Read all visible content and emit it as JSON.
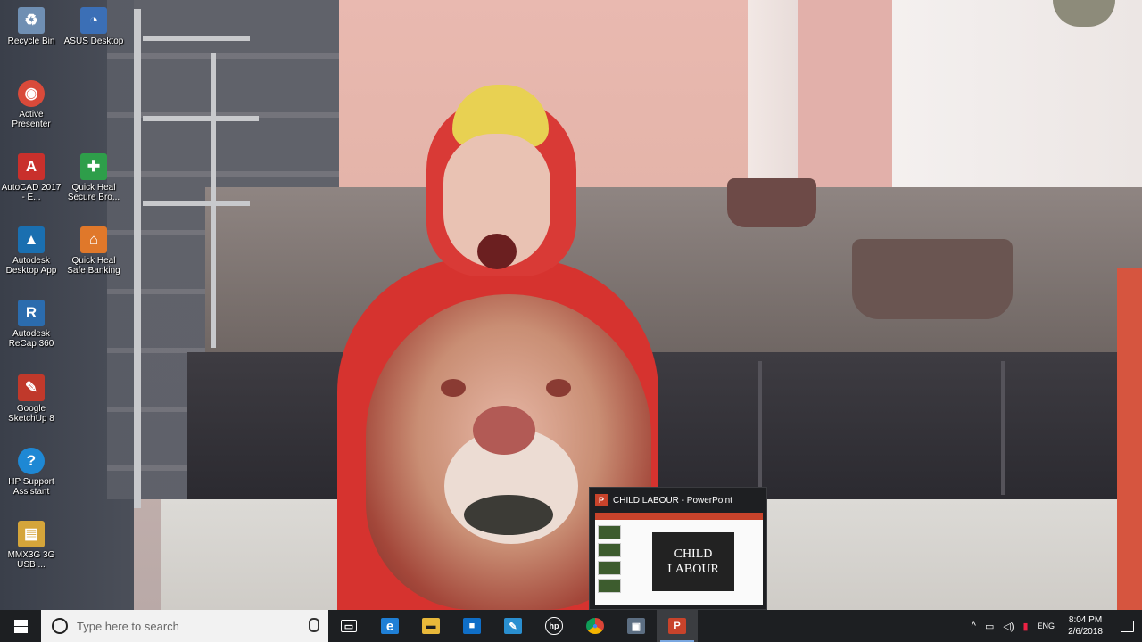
{
  "desktop_icons": [
    {
      "label": "Recycle Bin",
      "icon": "recycle-bin-icon",
      "color": "#6f8fb3"
    },
    {
      "label": "ASUS Desktop",
      "icon": "asus-icon",
      "color": "#3b6fb6"
    },
    {
      "label": "Active Presenter",
      "icon": "active-presenter-icon",
      "color": "#d94a3a"
    },
    {
      "label": "AutoCAD 2017 - E...",
      "icon": "autocad-icon",
      "color": "#c9302c"
    },
    {
      "label": "Quick Heal Secure Bro...",
      "icon": "quick-heal-icon",
      "color": "#2e9e4a"
    },
    {
      "label": "Autodesk Desktop App",
      "icon": "autodesk-icon",
      "color": "#1a6fb0"
    },
    {
      "label": "Quick Heal Safe Banking",
      "icon": "safe-banking-icon",
      "color": "#e0782a"
    },
    {
      "label": "Autodesk ReCap 360",
      "icon": "recap-icon",
      "color": "#2b6cae"
    },
    {
      "label": "Google SketchUp 8",
      "icon": "sketchup-icon",
      "color": "#c0392b"
    },
    {
      "label": "HP Support Assistant",
      "icon": "hp-support-icon",
      "color": "#1e88d4"
    },
    {
      "label": "MMX3G 3G USB ...",
      "icon": "modem-icon",
      "color": "#d5a53a"
    }
  ],
  "preview": {
    "title": "CHILD LABOUR - PowerPoint",
    "app_badge": "P",
    "slide_line1": "CHILD",
    "slide_line2": "LABOUR"
  },
  "taskbar": {
    "search_placeholder": "Type here to search",
    "apps": [
      {
        "name": "task-view",
        "glyph": "▭",
        "color": "#1d1f22"
      },
      {
        "name": "edge",
        "glyph": "e",
        "color": "#1f7fd6"
      },
      {
        "name": "file-explorer",
        "glyph": "▬",
        "color": "#e8b83a"
      },
      {
        "name": "store",
        "glyph": "■",
        "color": "#0f6ec7"
      },
      {
        "name": "snipping",
        "glyph": "✎",
        "color": "#2a8fd0"
      },
      {
        "name": "hp",
        "glyph": "hp",
        "color": "#1d1f22"
      },
      {
        "name": "chrome",
        "glyph": "●",
        "color": "#db4437"
      },
      {
        "name": "gadget",
        "glyph": "▣",
        "color": "#5c6e82"
      },
      {
        "name": "powerpoint",
        "glyph": "P",
        "color": "#c8432b"
      }
    ],
    "tray": {
      "chevron": "^",
      "lang": "ENG",
      "time": "8:04 PM",
      "date": "2/6/2018"
    }
  }
}
